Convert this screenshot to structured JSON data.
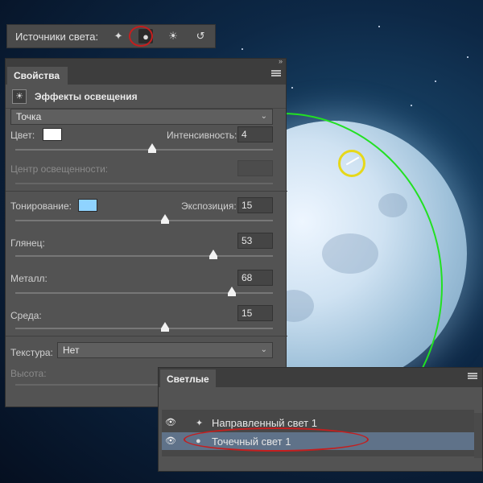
{
  "toolbar": {
    "label": "Источники света:",
    "icons": [
      "directional-light-icon",
      "point-light-icon",
      "infinite-light-icon",
      "reset-light-icon"
    ],
    "active_icon": "point-light-icon"
  },
  "properties": {
    "tab_label": "Свойства",
    "section_title": "Эффекты освещения",
    "light_type": "Точка",
    "color_label": "Цвет:",
    "color_value": "#ffffff",
    "intensity_label": "Интенсивность:",
    "intensity_value": "4",
    "hotspot_label": "Центр освещенности:",
    "tint_label": "Тонирование:",
    "tint_color": "#8fd3ff",
    "exposure_label": "Экспозиция:",
    "exposure_value": "15",
    "gloss_label": "Глянец:",
    "gloss_value": "53",
    "metallic_label": "Металл:",
    "metallic_value": "68",
    "ambience_label": "Среда:",
    "ambience_value": "15",
    "texture_label": "Текстура:",
    "texture_value": "Нет",
    "height_label": "Высота:",
    "sliders": {
      "intensity": 0.53,
      "exposure": 0.58,
      "gloss": 0.77,
      "metallic": 0.84,
      "ambience": 0.58
    }
  },
  "lights_panel": {
    "tab_label": "Светлые",
    "items": [
      {
        "name": "Направленный свет 1",
        "visible": true,
        "selected": false,
        "icon": "directional-light-icon"
      },
      {
        "name": "Точечный свет 1",
        "visible": true,
        "selected": true,
        "icon": "point-light-icon"
      }
    ]
  },
  "colors": {
    "spot_outline": "#22e022",
    "annotation_red": "#c41e1e",
    "selection": "#5f7289"
  }
}
